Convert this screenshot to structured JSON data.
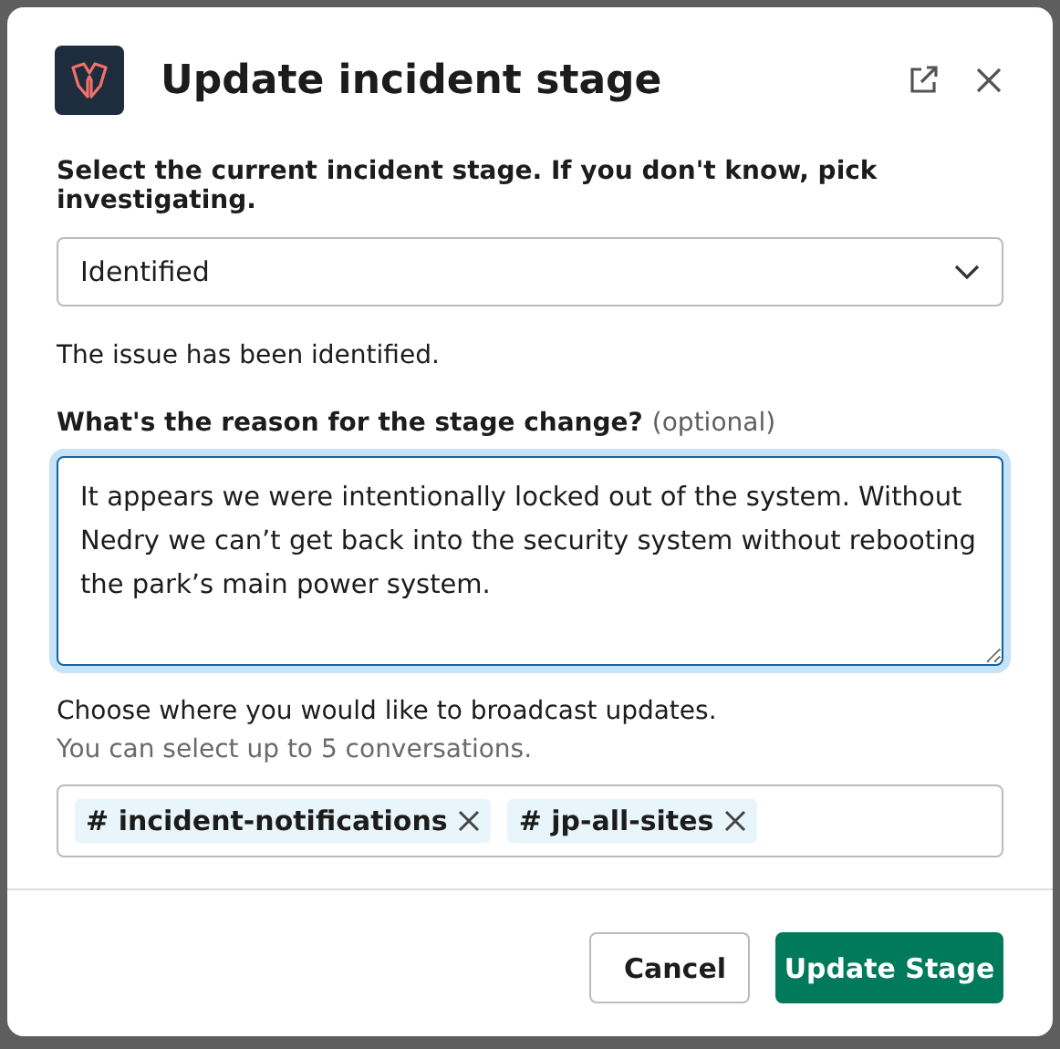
{
  "modal": {
    "title": "Update incident stage",
    "stage_label": "Select the current incident stage. If you don't know, pick investigating.",
    "stage_select": {
      "value": "Identified"
    },
    "stage_description": "The issue has been identified.",
    "reason_label": "What's the reason for the stage change?",
    "reason_hint": "(optional)",
    "reason_field": {
      "value": "It appears we were intentionally locked out of the system. Without Nedry we can’t get back into the security system without rebooting the park’s main power system.",
      "focused": true
    },
    "broadcast_label": "Choose where you would like to broadcast updates.",
    "broadcast_hint": "You can select up to 5 conversations.",
    "channels": [
      {
        "prefix": "#",
        "name": "incident-notifications"
      },
      {
        "prefix": "#",
        "name": "jp-all-sites"
      }
    ],
    "buttons": [
      {
        "label": "Cancel",
        "kind": "secondary"
      },
      {
        "label": "Update Stage",
        "kind": "primary"
      }
    ]
  }
}
